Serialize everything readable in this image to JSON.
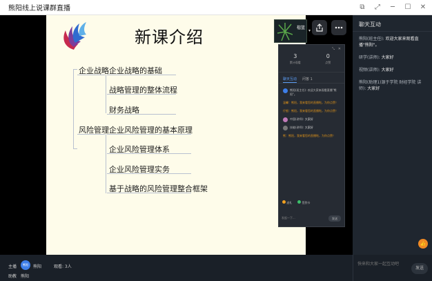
{
  "window": {
    "title": "熊阳线上说课群直播"
  },
  "slide": {
    "title": "新课介绍",
    "branches": [
      {
        "label": "企业战略",
        "children": [
          "企业战略的基础",
          "战略管理的整体流程",
          "财务战略"
        ]
      },
      {
        "label": "风险管理",
        "children": [
          "企业风险管理的基本原理",
          "企业风险管理体系",
          "企业风险管理实务",
          "基于战略的风险管理整合框架"
        ]
      }
    ]
  },
  "webcam": {
    "label": "楷篮"
  },
  "popup": {
    "stats": [
      {
        "num": "3",
        "label": "累计观看"
      },
      {
        "num": "0",
        "label": "点赞"
      }
    ],
    "tabs": [
      "聊天互动",
      "问答 1"
    ],
    "messages": [
      {
        "who": "熊阳(班主任):",
        "text": "欢迎大家来观看直播\"熊阳\"。",
        "type": "normal",
        "color": "#3d7ee8"
      },
      {
        "who": "",
        "text": "温馨：熊阳，我来看您的直播啦，为你点赞！",
        "type": "warn"
      },
      {
        "who": "",
        "text": "仔细：熊阳，我来看您的直播啦，为你点赞！",
        "type": "warn"
      },
      {
        "who": "中国(讲师):",
        "text": "大家好",
        "type": "normal",
        "color": "#c07ab8"
      },
      {
        "who": "技能(讲师):",
        "text": "大家好",
        "type": "normal",
        "color": "#777"
      },
      {
        "who": "",
        "text": "熊：熊阳，我来看您的直播啦，为你点赞！",
        "type": "warn"
      }
    ],
    "footer_links": [
      "送礼",
      "签到卡"
    ],
    "input_placeholder": "发起一下...",
    "send_label": "发送"
  },
  "chat_panel": {
    "header": "聊天互动",
    "messages": [
      {
        "who": "熊阳(班主任):",
        "text": "欢迎大家来观看直播\"熊阳\"。"
      },
      {
        "who": "研学(讲师):",
        "text": "大家好"
      },
      {
        "who": "视频(讲师):",
        "text": "大家好"
      },
      {
        "who": "熊阳(助理1)源于学院 财经学院 讲师):",
        "text": "大家好"
      }
    ]
  },
  "bottom": {
    "host_label": "主播",
    "host_avatar": "熊阳",
    "host_name": "熊阳",
    "viewers_label": "观看: 3人",
    "assistant_label": "助教",
    "assistant_name": "熊阳",
    "input_placeholder": "快来和大家一起互动吧",
    "send_label": "发送",
    "like_icon": "thumbs-up-icon"
  }
}
